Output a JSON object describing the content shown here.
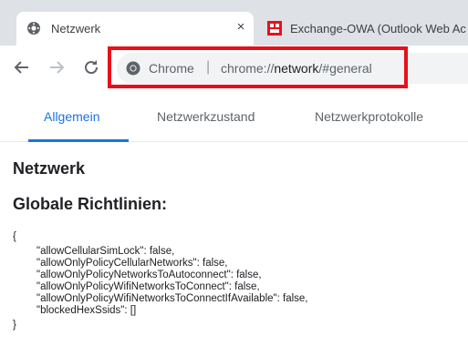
{
  "browser": {
    "tabs": [
      {
        "title": "Netzwerk",
        "active": true,
        "icon": "settings-gear-icon",
        "close_glyph": "×"
      },
      {
        "title": "Exchange-OWA (Outlook Web Ac",
        "active": false,
        "icon": "owa-logo-icon"
      }
    ],
    "omnibox": {
      "scheme_label": "Chrome",
      "separator": "|",
      "url_prefix": "chrome://",
      "url_host": "network",
      "url_suffix": "/#general"
    },
    "highlight_color": "#e8101a"
  },
  "page": {
    "tabs": [
      {
        "label": "Allgemein",
        "active": true
      },
      {
        "label": "Netzwerkzustand",
        "active": false
      },
      {
        "label": "Netzwerkprotokolle",
        "active": false
      }
    ],
    "heading": "Netzwerk",
    "subheading": "Globale Richtlinien:",
    "policy_json": {
      "open": "{",
      "lines": [
        "\"allowCellularSimLock\": false,",
        "\"allowOnlyPolicyCellularNetworks\": false,",
        "\"allowOnlyPolicyNetworksToAutoconnect\": false,",
        "\"allowOnlyPolicyWifiNetworksToConnect\": false,",
        "\"allowOnlyPolicyWifiNetworksToConnectIfAvailable\": false,",
        "\"blockedHexSsids\": []"
      ],
      "close": "}"
    }
  },
  "colors": {
    "accent": "#1a73e8",
    "highlight": "#e8101a",
    "tabstrip": "#dee1e6"
  }
}
